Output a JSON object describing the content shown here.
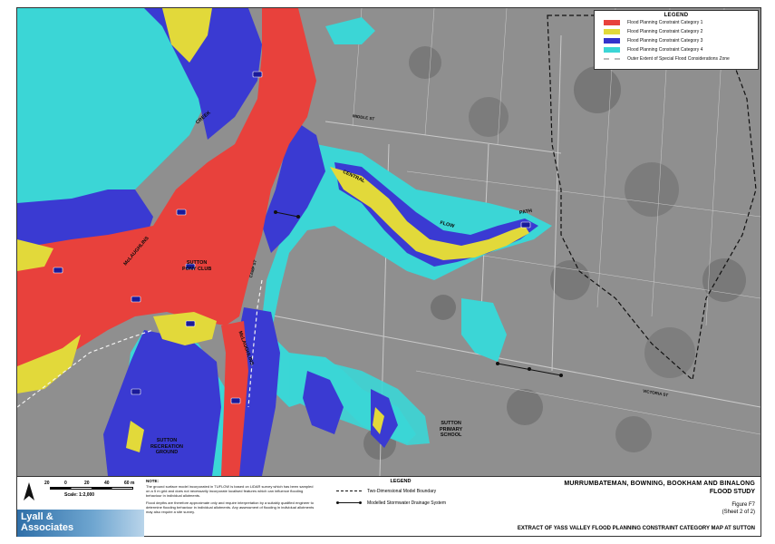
{
  "legend": {
    "title": "LEGEND",
    "items": [
      {
        "label": "Flood Planning Constraint Category 1",
        "color": "#e8413c"
      },
      {
        "label": "Flood Planning Constraint Category 2",
        "color": "#e2d93a"
      },
      {
        "label": "Flood Planning Constraint Category 3",
        "color": "#3333cc"
      },
      {
        "label": "Flood Planning Constraint Category 4",
        "color": "#3bd6d6"
      },
      {
        "label": "Outer Extent of Special Flood Considerations Zone",
        "color": "#cccccc"
      }
    ]
  },
  "map_labels": {
    "creek": "CREEK",
    "central": "CENTRAL",
    "flow": "FLOW",
    "path": "PATH",
    "mclaughlins_upper": "McLAUGHLINS",
    "mclaughlins_lower": "McLAUGHLINS",
    "pony_club": "SUTTON\nPONY CLUB",
    "recreation_ground": "SUTTON\nRECREATION\nGROUND",
    "primary_school": "SUTTON\nPRIMARY\nSCHOOL"
  },
  "road_labels": {
    "middle_st": "MIDDLE ST",
    "camp_st": "CAMP ST",
    "victoria_st": "VICTORIA ST"
  },
  "footer": {
    "scale_ticks": [
      "20",
      "0",
      "20",
      "40",
      "60 m"
    ],
    "scale_text": "Scale: 1:2,000",
    "logo_line1": "Lyall &",
    "logo_line2": "Associates",
    "note_title": "NOTE:",
    "note_para1": "The ground surface model incorporated in TUFLOW is based on LiDAR survey which has been sampled on a 5 m grid and does not necessarily incorporate localised features which can influence flooding behaviour in individual allotments.",
    "note_para2": "Flood depths are therefore approximate only and require interpretation by a suitably qualified engineer to determine flooding behaviour in individual allotments. Any assessment of flooding in individual allotments may also require a site survey.",
    "legend_title": "LEGEND",
    "legend_model_boundary": "Two-Dimensional Model Boundary",
    "legend_stormwater": "Modelled Stormwater Drainage System",
    "title1": "MURRUMBATEMAN, BOWNING, BOOKHAM AND BINALONG",
    "title2": "FLOOD STUDY",
    "figure": "Figure F7",
    "sheet": "(Sheet 2 of 2)",
    "extract": "EXTRACT OF YASS VALLEY FLOOD PLANNING CONSTRAINT CATEGORY MAP AT SUTTON"
  }
}
